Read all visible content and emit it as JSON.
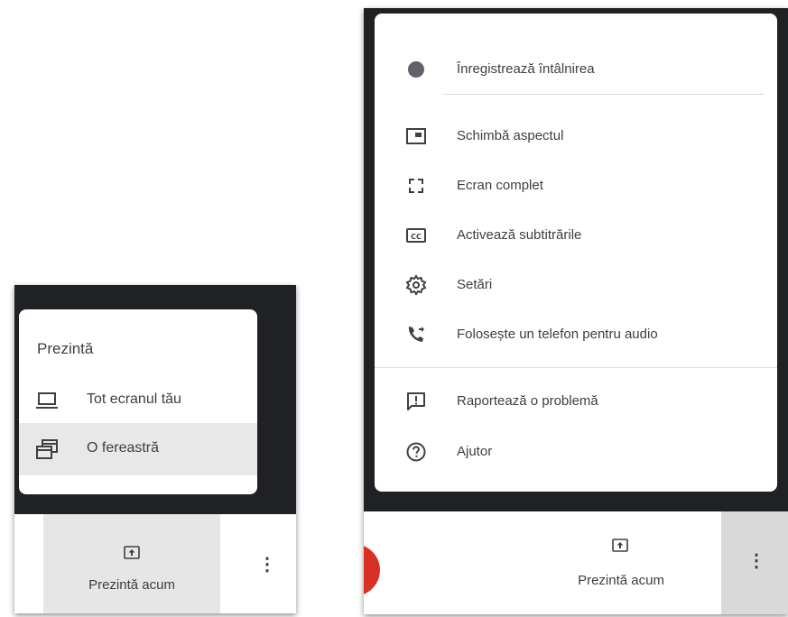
{
  "present_panel": {
    "title": "Prezintă",
    "options": [
      {
        "label": "Tot ecranul tău",
        "icon": "laptop-icon"
      },
      {
        "label": "O fereastră",
        "icon": "window-icon",
        "highlighted": true
      }
    ]
  },
  "left_toolbar": {
    "present_now_label": "Prezintă acum",
    "present_icon": "present-to-all-icon",
    "more_icon": "more-vert-icon"
  },
  "more_menu": {
    "items": [
      {
        "label": "Înregistrează întâlnirea",
        "icon": "record-icon"
      },
      {
        "label": "Schimbă aspectul",
        "icon": "layout-icon"
      },
      {
        "label": "Ecran complet",
        "icon": "fullscreen-icon"
      },
      {
        "label": "Activează subtitrările",
        "icon": "closed-captions-icon"
      },
      {
        "label": "Setări",
        "icon": "gear-icon"
      },
      {
        "label": "Folosește un telefon pentru audio",
        "icon": "phone-forwarded-icon"
      },
      {
        "label": "Raportează o problemă",
        "icon": "report-problem-icon"
      },
      {
        "label": "Ajutor",
        "icon": "help-icon"
      }
    ]
  },
  "right_toolbar": {
    "present_now_label": "Prezintă acum",
    "present_icon": "present-to-all-icon",
    "more_icon": "more-vert-icon",
    "record_color": "#d93025",
    "more_active_bg": "#d9d9d9"
  },
  "colors": {
    "dark_background": "#202124",
    "text": "#3c4043",
    "highlight": "#e8e8e8"
  }
}
